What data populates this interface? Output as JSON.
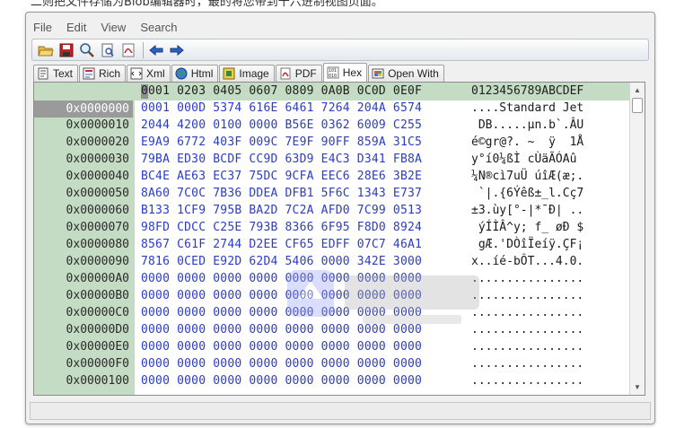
{
  "top_caption": "二则把文件存储为Blob编辑器时，最的将您带到十六进制视图页面。",
  "menu": [
    "File",
    "Edit",
    "View",
    "Search"
  ],
  "toolbar_icons": [
    "open-folder-icon",
    "save-icon",
    "search-icon",
    "print-preview-icon",
    "pdf-export-icon",
    "back-arrow-icon",
    "forward-arrow-icon"
  ],
  "tabs": [
    {
      "label": "Text",
      "icon": "text-icon",
      "active": false
    },
    {
      "label": "Rich",
      "icon": "rich-text-icon",
      "active": false
    },
    {
      "label": "Xml",
      "icon": "xml-icon",
      "active": false
    },
    {
      "label": "Html",
      "icon": "html-globe-icon",
      "active": false
    },
    {
      "label": "Image",
      "icon": "image-icon",
      "active": false
    },
    {
      "label": "PDF",
      "icon": "pdf-icon",
      "active": false
    },
    {
      "label": "Hex",
      "icon": "hex-icon",
      "active": true
    },
    {
      "label": "Open With",
      "icon": "open-with-icon",
      "active": false
    }
  ],
  "hex": {
    "header_hex": "0001 0203 0405 0607 0809 0A0B 0C0D 0E0F",
    "header_ascii": "0123456789ABCDEF",
    "rows": [
      {
        "addr": "0x0000000",
        "hex": "0001 000D 5374 616E 6461 7264 204A 6574",
        "ascii": "....Standard Jet"
      },
      {
        "addr": "0x0000010",
        "hex": "2044 4200 0100 0000 B56E 0362 6009 C255",
        "ascii": " DB.....µn.b`.ÂU"
      },
      {
        "addr": "0x0000020",
        "hex": "E9A9 6772 403F 009C 7E9F 90FF 859A 31C5",
        "ascii": "é©gr@?. ~  ÿ  1Å"
      },
      {
        "addr": "0x0000030",
        "hex": "79BA ED30 BCDF CC9D 63D9 E4C3 D341 FB8A",
        "ascii": "y°í0¼ßÌ cÙäÃÓAû"
      },
      {
        "addr": "0x0000040",
        "hex": "BC4E AE63 EC37 75DC 9CFA EEC6 28E6 3B2E",
        "ascii": "¼N®cì7uÜ úîÆ(æ;."
      },
      {
        "addr": "0x0000050",
        "hex": "8A60 7C0C 7B36 DDEA DFB1 5F6C 1343 E737",
        "ascii": " `|.{6Ýêß±_l.Cç7"
      },
      {
        "addr": "0x0000060",
        "hex": "B133 1CF9 795B BA2D 7C2A AFD0 7C99 0513",
        "ascii": "±3.ùy[°-|*¯Ð| .."
      },
      {
        "addr": "0x0000070",
        "hex": "98FD CDCC C25E 793B 8366 6F95 F8D0 8924",
        "ascii": " ýÍÌÂ^y; f_ øÐ $"
      },
      {
        "addr": "0x0000080",
        "hex": "8567 C61F 2744 D2EE CF65 EDFF 07C7 46A1",
        "ascii": " gÆ.'DÒîÏeíÿ.ÇF¡"
      },
      {
        "addr": "0x0000090",
        "hex": "7816 0CED E92D 62D4 5406 0000 342E 3000",
        "ascii": "x..íé-bÔT...4.0."
      },
      {
        "addr": "0x00000A0",
        "hex": "0000 0000 0000 0000 0000 0000 0000 0000",
        "ascii": "................"
      },
      {
        "addr": "0x00000B0",
        "hex": "0000 0000 0000 0000 0000 0000 0000 0000",
        "ascii": "................"
      },
      {
        "addr": "0x00000C0",
        "hex": "0000 0000 0000 0000 0000 0000 0000 0000",
        "ascii": "................"
      },
      {
        "addr": "0x00000D0",
        "hex": "0000 0000 0000 0000 0000 0000 0000 0000",
        "ascii": "................"
      },
      {
        "addr": "0x00000E0",
        "hex": "0000 0000 0000 0000 0000 0000 0000 0000",
        "ascii": "................"
      },
      {
        "addr": "0x00000F0",
        "hex": "0000 0000 0000 0000 0000 0000 0000 0000",
        "ascii": "................"
      },
      {
        "addr": "0x0000100",
        "hex": "0000 0000 0000 0000 0000 0000 0000 0000",
        "ascii": "................"
      }
    ]
  },
  "colors": {
    "hex_text": "#2a3cc8",
    "gutter": "#c4dcc4",
    "selected_addr": "#9a9a9a"
  }
}
